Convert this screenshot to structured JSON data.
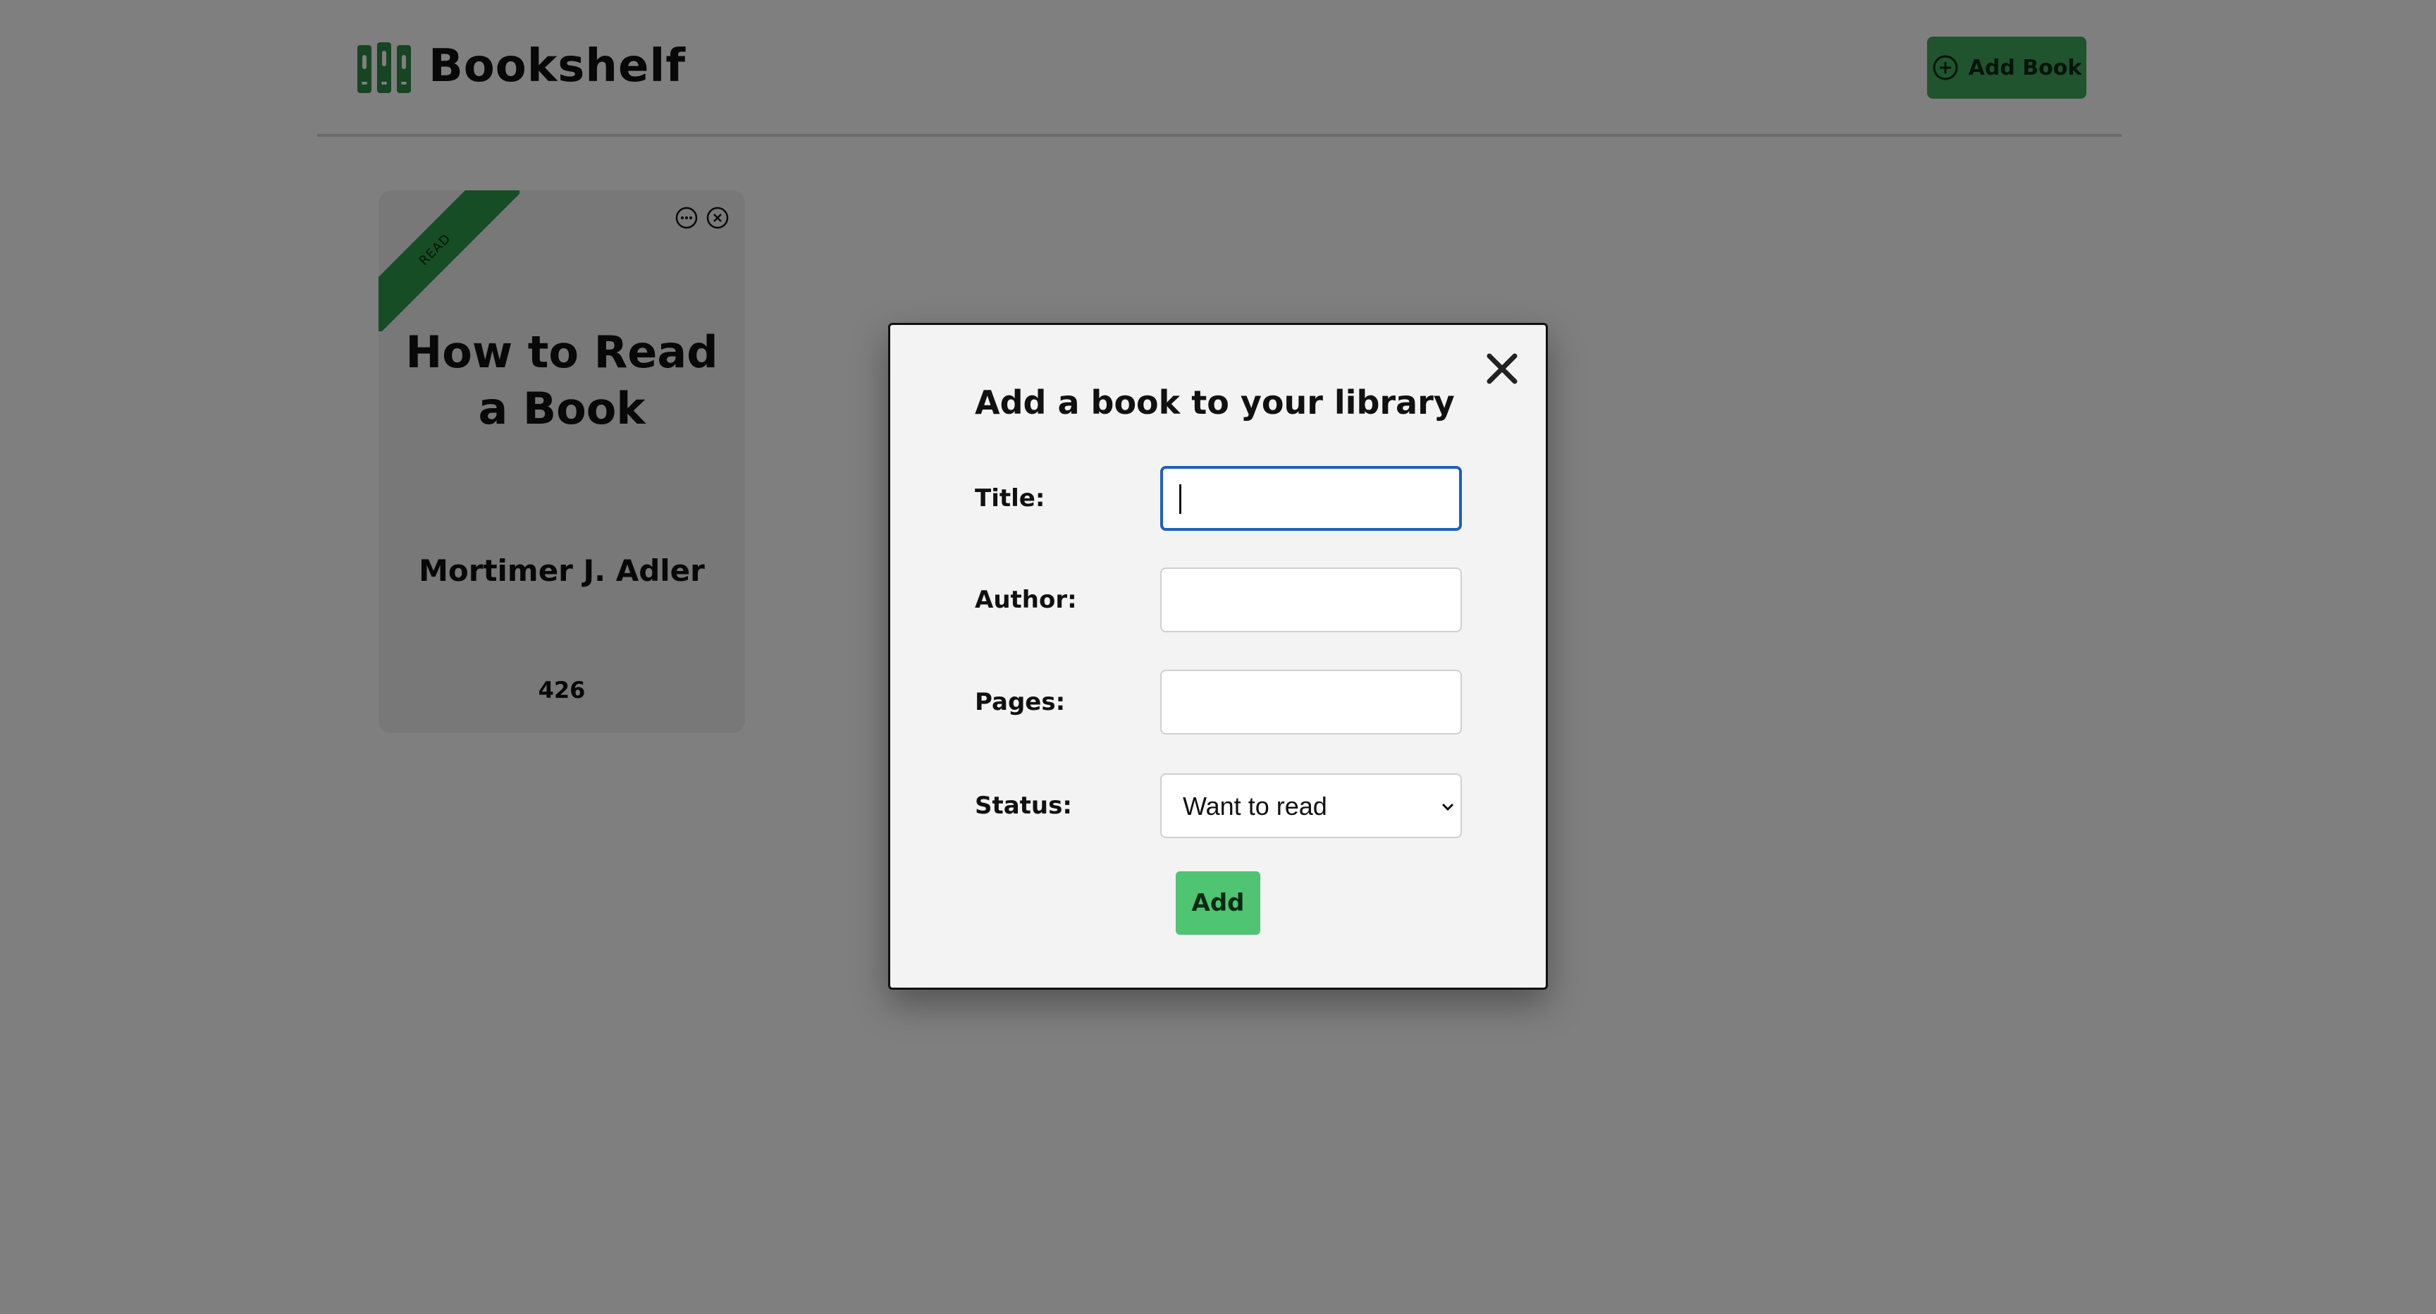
{
  "header": {
    "brand": "Bookshelf",
    "logo_icon": "bookshelf-logo-icon",
    "add_book_label": "Add Book",
    "add_book_icon": "plus-circle-icon"
  },
  "colors": {
    "accent": "#3fa85d",
    "ribbon": "#2e9a4a",
    "submit": "#4fc472",
    "focus": "#1f5fbf",
    "overlay": "rgba(0,0,0,0.5)"
  },
  "books": [
    {
      "status_ribbon": "READ",
      "title": "How to Read a Book",
      "author": "Mortimer J. Adler",
      "pages": "426",
      "actions": [
        "edit-icon",
        "remove-icon"
      ]
    }
  ],
  "modal": {
    "title": "Add a book to your library",
    "close_icon": "close-icon",
    "fields": {
      "title_label": "Title:",
      "title_value": "",
      "author_label": "Author:",
      "author_value": "",
      "pages_label": "Pages:",
      "pages_value": "",
      "status_label": "Status:",
      "status_value": "Want to read"
    },
    "submit_label": "Add"
  }
}
